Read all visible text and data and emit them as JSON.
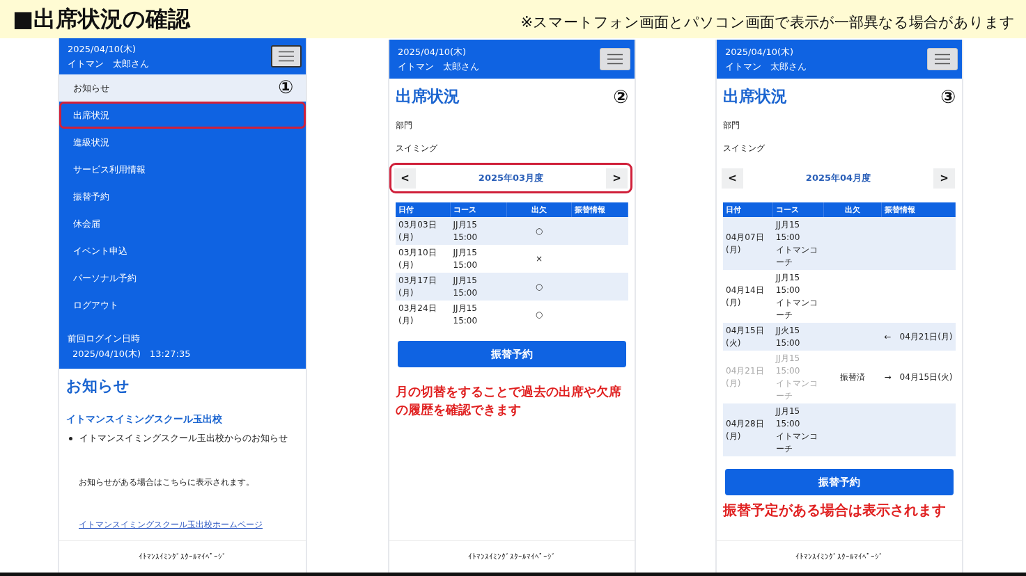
{
  "slide": {
    "title": "■出席状況の確認",
    "note": "※スマートフォン画面とパソコン画面で表示が一部異なる場合があります"
  },
  "screens": [
    {
      "kind": "menu",
      "header": {
        "date": "2025/04/10(木)",
        "user": "イトマン　太郎さん"
      },
      "number": "①",
      "menu": [
        {
          "label": "お知らせ",
          "selected": true,
          "highlighted": false
        },
        {
          "label": "出席状況",
          "selected": false,
          "highlighted": true
        },
        {
          "label": "進級状況",
          "selected": false,
          "highlighted": false
        },
        {
          "label": "サービス利用情報",
          "selected": false,
          "highlighted": false
        },
        {
          "label": "振替予約",
          "selected": false,
          "highlighted": false
        },
        {
          "label": "休会届",
          "selected": false,
          "highlighted": false
        },
        {
          "label": "イベント申込",
          "selected": false,
          "highlighted": false
        },
        {
          "label": "パーソナル予約",
          "selected": false,
          "highlighted": false
        },
        {
          "label": "ログアウト",
          "selected": false,
          "highlighted": false
        }
      ],
      "last_login": {
        "label": "前回ログイン日時",
        "value": "2025/04/10(木)　13:27:35"
      },
      "notice": {
        "heading": "お知らせ",
        "school": "イトマンスイミングスクール玉出校",
        "items": [
          "イトマンスイミングスクール玉出校からのお知らせ"
        ],
        "message": "お知らせがある場合はこちらに表示されます。",
        "link": "イトマンスイミングスクール玉出校ホームページ"
      },
      "footer": "ｲﾄﾏﾝｽｲﾐﾝｸﾞｽｸｰﾙﾏｲﾍﾟｰｼﾞ"
    },
    {
      "kind": "attendance",
      "header": {
        "date": "2025/04/10(木)",
        "user": "イトマン　太郎さん"
      },
      "number": "②",
      "title": "出席状況",
      "field_label": "部門",
      "field_value": "スイミング",
      "month_selector": {
        "prev": "<",
        "month": "2025年03月度",
        "next": ">",
        "highlighted": true
      },
      "columns": [
        "日付",
        "コース",
        "出欠",
        "振替情報"
      ],
      "rows": [
        {
          "date": "03月03日\n(月)",
          "course": "JJ月15\n15:00",
          "attendance": "○",
          "transfer": "",
          "disabled": false
        },
        {
          "date": "03月10日\n(月)",
          "course": "JJ月15\n15:00",
          "attendance": "×",
          "transfer": "",
          "disabled": false
        },
        {
          "date": "03月17日\n(月)",
          "course": "JJ月15\n15:00",
          "attendance": "○",
          "transfer": "",
          "disabled": false
        },
        {
          "date": "03月24日\n(月)",
          "course": "JJ月15\n15:00",
          "attendance": "○",
          "transfer": "",
          "disabled": false
        }
      ],
      "button": "振替予約",
      "annotation": "月の切替をすることで過去の出席や欠席の履歴を確認できます",
      "footer": "ｲﾄﾏﾝｽｲﾐﾝｸﾞｽｸｰﾙﾏｲﾍﾟｰｼﾞ"
    },
    {
      "kind": "attendance",
      "header": {
        "date": "2025/04/10(木)",
        "user": "イトマン　太郎さん"
      },
      "number": "③",
      "title": "出席状況",
      "field_label": "部門",
      "field_value": "スイミング",
      "month_selector": {
        "prev": "<",
        "month": "2025年04月度",
        "next": ">",
        "highlighted": false
      },
      "columns": [
        "日付",
        "コース",
        "出欠",
        "振替情報"
      ],
      "rows": [
        {
          "date": "04月07日\n(月)",
          "course": "JJ月15\n15:00\nイトマンコーチ",
          "attendance": "",
          "transfer": "",
          "disabled": false
        },
        {
          "date": "04月14日\n(月)",
          "course": "JJ月15\n15:00\nイトマンコーチ",
          "attendance": "",
          "transfer": "",
          "disabled": false
        },
        {
          "date": "04月15日\n(火)",
          "course": "JJ火15\n15:00",
          "attendance": "",
          "transfer": "←　04月21日(月)",
          "disabled": false
        },
        {
          "date": "04月21日\n(月)",
          "course": "JJ月15\n15:00\nイトマンコーチ",
          "attendance": "振替済",
          "transfer": "→　04月15日(火)",
          "disabled": true
        },
        {
          "date": "04月28日\n(月)",
          "course": "JJ月15\n15:00\nイトマンコーチ",
          "attendance": "",
          "transfer": "",
          "disabled": false
        }
      ],
      "button": "振替予約",
      "annotation": "振替予定がある場合は表示されます",
      "footer": "ｲﾄﾏﾝｽｲﾐﾝｸﾞｽｸｰﾙﾏｲﾍﾟｰｼﾞ"
    }
  ]
}
